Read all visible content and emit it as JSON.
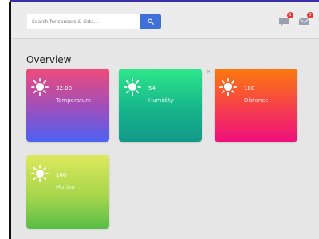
{
  "header": {
    "search": {
      "placeholder": "Search for sensors & data..."
    },
    "search_button": {
      "icon": "search-icon"
    },
    "chat": {
      "icon": "chat-icon",
      "badge": "1"
    },
    "mail": {
      "icon": "mail-icon",
      "badge": "3"
    }
  },
  "main": {
    "title": "Overview",
    "stray_mark": "×",
    "cards": [
      {
        "label": "Temperature",
        "value": "32.00",
        "icon": "sun-icon"
      },
      {
        "label": "Humidity",
        "value": "54",
        "icon": "sun-icon"
      },
      {
        "label": "Distance",
        "value": "100",
        "icon": "sun-icon"
      },
      {
        "label": "Motion",
        "value": "100",
        "icon": "sun-icon"
      }
    ]
  },
  "colors": {
    "top_bar": "#3a2fa8",
    "search_button": "#3f6fd8",
    "badge": "#e53935",
    "temperature_card": [
      "#ee4b79",
      "#4d61f2"
    ],
    "humidity_card": [
      "#2ee88b",
      "#139989"
    ],
    "distance_card": [
      "#fb7a0c",
      "#ee0f7c"
    ],
    "motion_card": [
      "#dde85b",
      "#58bd46"
    ]
  }
}
